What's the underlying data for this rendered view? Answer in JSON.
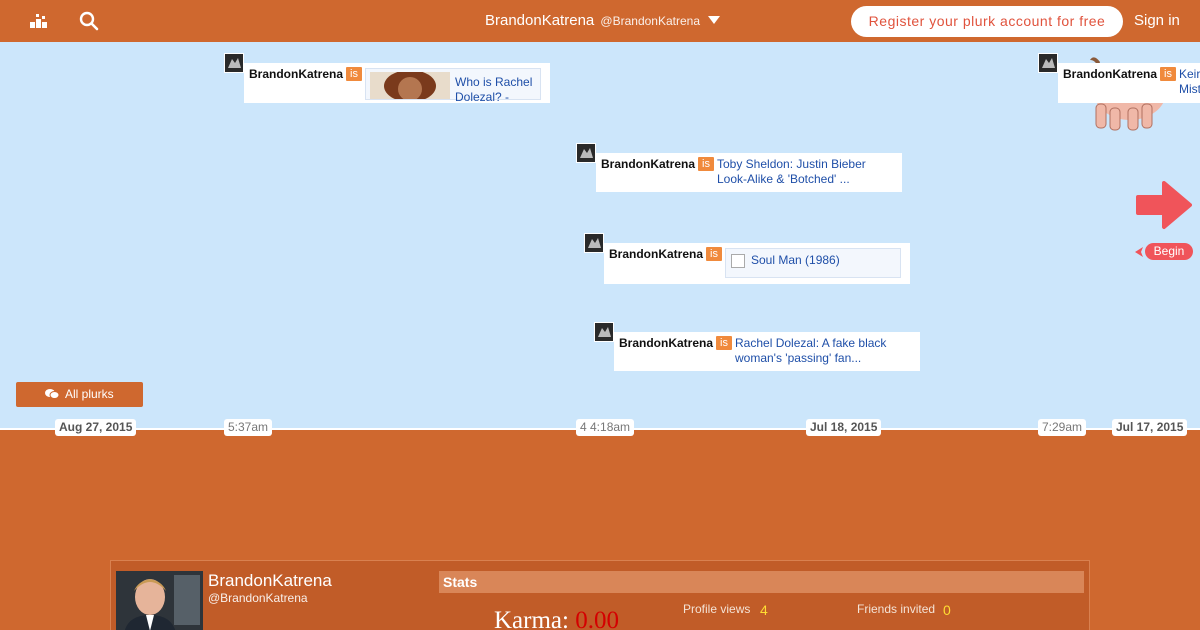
{
  "topbar": {
    "user_name": "BrandonKatrena",
    "user_handle": "@BrandonKatrena",
    "register_label": "Register your plurk account for free",
    "signin_label": "Sign in"
  },
  "plurks": [
    {
      "author": "BrandonKatrena",
      "qualifier": "is",
      "text": "Who is Rachel Dolezal? -"
    },
    {
      "author": "BrandonKatrena",
      "qualifier": "is",
      "text": "Toby Sheldon: Justin Bieber Look-Alike & 'Botched' ..."
    },
    {
      "author": "BrandonKatrena",
      "qualifier": "is",
      "text": "Soul Man (1986)"
    },
    {
      "author": "BrandonKatrena",
      "qualifier": "is",
      "text": "Rachel Dolezal: A fake black woman's 'passing' fan..."
    },
    {
      "author": "BrandonKatrena",
      "qualifier": "is",
      "text": "Keir Mist"
    }
  ],
  "controls": {
    "all_plurks_label": "All plurks",
    "begin_label": "Begin"
  },
  "axis": {
    "ticks": [
      "Aug 27, 2015",
      "5:37am",
      "4 4:18am",
      "Jul 18, 2015",
      "7:29am",
      "Jul 17, 2015"
    ]
  },
  "profile": {
    "name": "BrandonKatrena",
    "handle": "@BrandonKatrena",
    "stats_title": "Stats",
    "karma_label": "Karma:",
    "karma_value": "0.00",
    "profile_views_label": "Profile views",
    "profile_views_value": "4",
    "friends_invited_label": "Friends invited",
    "friends_invited_value": "0"
  },
  "colors": {
    "brand_orange": "#cf682f",
    "timeline_bg": "#cce6fb",
    "register_text": "#e0533d",
    "begin_red": "#f0545a",
    "karma_red": "#d40000",
    "stat_yellow": "#ffdd33"
  }
}
